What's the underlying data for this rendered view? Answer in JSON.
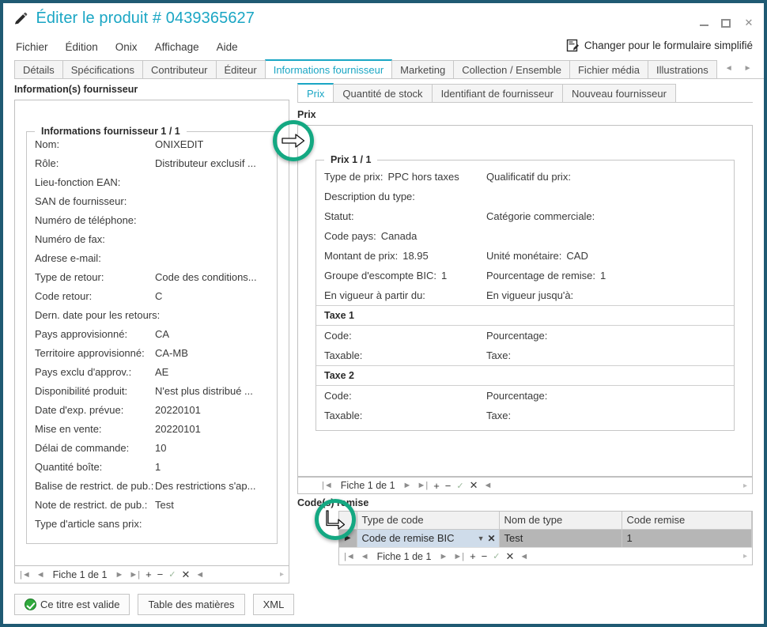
{
  "window": {
    "title": "Éditer le produit # 0439365627",
    "title_icon": "pencil-icon",
    "minimize": "–",
    "maximize": "□",
    "close": "✕"
  },
  "menu": {
    "items": [
      "Fichier",
      "Édition",
      "Onix",
      "Affichage",
      "Aide"
    ],
    "switch_form_label": "Changer pour le formulaire simplifié",
    "switch_form_icon": "form-switch-icon"
  },
  "main_tabs": {
    "items": [
      "Détails",
      "Spécifications",
      "Contributeur",
      "Éditeur",
      "Informations fournisseur",
      "Marketing",
      "Collection / Ensemble",
      "Fichier média",
      "Illustrations"
    ],
    "active": "Informations fournisseur",
    "scroll_left": "◄",
    "scroll_right": "►"
  },
  "left_pane": {
    "caption": "Information(s) fournisseur",
    "group_legend": "Informations fournisseur 1 / 1",
    "fields": [
      {
        "label": "Nom:",
        "value": "ONIXEDIT"
      },
      {
        "label": "Rôle:",
        "value": "Distributeur exclusif ..."
      },
      {
        "label": "Lieu-fonction EAN:",
        "value": ""
      },
      {
        "label": "SAN de fournisseur:",
        "value": ""
      },
      {
        "label": "Numéro de téléphone:",
        "value": ""
      },
      {
        "label": "Numéro de fax:",
        "value": ""
      },
      {
        "label": "Adrese e-mail:",
        "value": ""
      },
      {
        "label": "Type de retour:",
        "value": "Code des conditions..."
      },
      {
        "label": "Code retour:",
        "value": "C"
      },
      {
        "label": "Dern. date pour les retours:",
        "value": ""
      },
      {
        "label": "Pays approvisionné:",
        "value": "CA"
      },
      {
        "label": "Territoire approvisionné:",
        "value": "CA-MB"
      },
      {
        "label": "Pays exclu d'approv.:",
        "value": "AE"
      },
      {
        "label": "Disponibilité produit:",
        "value": "N'est plus distribué ..."
      },
      {
        "label": "Date d'exp. prévue:",
        "value": "20220101"
      },
      {
        "label": "Mise en vente:",
        "value": "20220101"
      },
      {
        "label": "Délai de commande:",
        "value": "10"
      },
      {
        "label": "Quantité boîte:",
        "value": "1"
      },
      {
        "label": "Balise de restrict. de pub.:",
        "value": "Des restrictions s'ap..."
      },
      {
        "label": "Note de restrict. de pub.:",
        "value": "Test"
      },
      {
        "label": "Type d'article sans prix:",
        "value": ""
      }
    ],
    "navigator": {
      "first": "|◄",
      "prev": "◄",
      "label": "Fiche 1 de 1",
      "next": "►",
      "last": "►|",
      "add": "+",
      "remove": "−",
      "confirm": "✓",
      "cancel": "✕",
      "refresh": "◄"
    }
  },
  "right_pane": {
    "sub_tabs": {
      "items": [
        "Prix",
        "Quantité de stock",
        "Identifiant de fournisseur",
        "Nouveau fournisseur"
      ],
      "active": "Prix"
    },
    "caption": "Prix",
    "group_legend": "Prix 1 / 1",
    "price_fields": [
      {
        "label": "Type de prix:",
        "value": "PPC hors taxes"
      },
      {
        "label": "Qualificatif du prix:",
        "value": ""
      },
      {
        "label": "Description du type:",
        "value": ""
      },
      {
        "label": "",
        "value": ""
      },
      {
        "label": "Statut:",
        "value": ""
      },
      {
        "label": "Catégorie commerciale:",
        "value": ""
      },
      {
        "label": "Code pays:",
        "value": "Canada"
      },
      {
        "label": "",
        "value": ""
      },
      {
        "label": "Montant de prix:",
        "value": "18.95"
      },
      {
        "label": "Unité monétaire:",
        "value": "CAD"
      },
      {
        "label": "Groupe d'escompte BIC:",
        "value": "1"
      },
      {
        "label": "Pourcentage de remise:",
        "value": "1"
      },
      {
        "label": "En vigueur à partir du:",
        "value": ""
      },
      {
        "label": "En vigueur jusqu'à:",
        "value": ""
      }
    ],
    "tax_sections": [
      {
        "header": "Taxe 1",
        "fields": [
          {
            "label": "Code:",
            "value": ""
          },
          {
            "label": "Pourcentage:",
            "value": ""
          },
          {
            "label": "Taxable:",
            "value": ""
          },
          {
            "label": "Taxe:",
            "value": ""
          }
        ]
      },
      {
        "header": "Taxe 2",
        "fields": [
          {
            "label": "Code:",
            "value": ""
          },
          {
            "label": "Pourcentage:",
            "value": ""
          },
          {
            "label": "Taxable:",
            "value": ""
          },
          {
            "label": "Taxe:",
            "value": ""
          }
        ]
      }
    ],
    "price_navigator": {
      "first": "|◄",
      "prev": "◄",
      "label": "Fiche 1 de 1",
      "next": "►",
      "last": "►|",
      "add": "+",
      "remove": "−",
      "confirm": "✓",
      "cancel": "✕",
      "refresh": "◄"
    },
    "discount": {
      "caption": "Code(s) remise",
      "columns": [
        "Type de code",
        "Nom de type",
        "Code remise"
      ],
      "rows": [
        {
          "marker": "▶",
          "type_code": "Code de remise BIC",
          "type_name": "Test",
          "discount_code": "1"
        }
      ],
      "navigator": {
        "first": "|◄",
        "prev": "◄",
        "label": "Fiche 1 de 1",
        "next": "►",
        "last": "►|",
        "add": "+",
        "remove": "−",
        "confirm": "✓",
        "cancel": "✕",
        "refresh": "◄"
      }
    }
  },
  "footer": {
    "valid_label": "Ce titre est valide",
    "toc_label": "Table des matières",
    "xml_label": "XML"
  },
  "annotations": [
    {
      "name": "arrow-right-marker",
      "icon": "arrow-right"
    },
    {
      "name": "arrow-corner-marker",
      "icon": "arrow-corner"
    }
  ],
  "colors": {
    "window_border": "#1f5a73",
    "accent": "#1aa6c4",
    "annotation": "#14a882",
    "selection_row": "#b6b6b6",
    "edit_cell": "#cfdcea"
  }
}
